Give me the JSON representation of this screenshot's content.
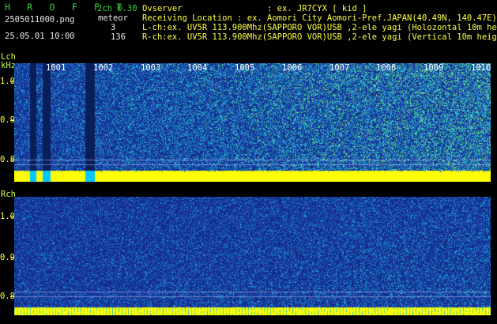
{
  "header": {
    "title": "H R O F F T",
    "filename": "2505011000.png",
    "datetime": "25.05.01 10:00",
    "version": "2ch 0.30",
    "meteor_label": "meteor",
    "lch_count": "3",
    "rch_count": "136",
    "observer": "Ovserver                 : ex. JR7CYX [ kid ]",
    "location": "Receiving Location : ex. Aomori City Aomori-Pref.JAPAN(40.49N, 140.47E)",
    "lch_desc": "L-ch:ex. UV5R 113.900Mhz(SAPPORO VOR)USB ,2-ele yagi (Holozontal 10m height)",
    "rch_desc": "R-ch:ex. UV5R 113.900Mhz(SAPPORO VOR)USB ,2-ele yagi (Vertical 10m height)"
  },
  "lch": {
    "label_line1": "Lch",
    "label_line2": "kHz",
    "yticks": [
      "1.0",
      "0.9",
      "0.8"
    ],
    "xticks": [
      "1001",
      "1002",
      "1003",
      "1004",
      "1005",
      "1006",
      "1007",
      "1008",
      "1009",
      "1010"
    ]
  },
  "rch": {
    "label": "Rch",
    "yticks": [
      "1.0",
      "0.9",
      "0.8"
    ]
  },
  "colors": {
    "background": "#000000",
    "header_green": "#38d438",
    "header_yellow": "#ffff40",
    "axis_yellow": "#ffff40",
    "noise_blue": "#1a3a9a",
    "band_yellow": "#ffff00"
  }
}
